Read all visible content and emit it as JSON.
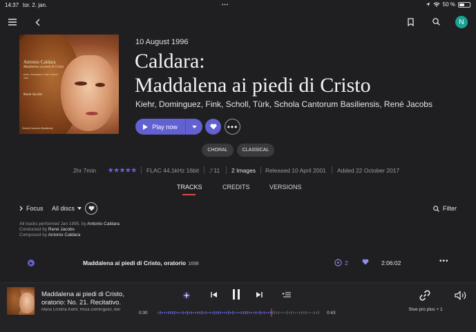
{
  "status_bar": {
    "time": "14:37",
    "date": "tor. 2. jan.",
    "battery": "50 %"
  },
  "album": {
    "release_date_top": "10 August 1996",
    "title_line1": "Caldara:",
    "title_line2": "Maddalena ai piedi di Cristo",
    "performers": "Kiehr, Dominguez, Fink, Scholl, Türk, Schola Cantorum Basiliensis, René Jacobs",
    "cover": {
      "composer": "Antonio Caldara",
      "work": "Maddalena ai piedi di Cristo",
      "singers": "Kiehr • Dominguez • Fink • Scholl • Türk",
      "ensemble": "Schola Cantorum Basiliensis",
      "conductor": "René Jacobs"
    }
  },
  "actions": {
    "play_label": "Play now"
  },
  "genres": [
    "CHORAL",
    "CLASSICAL"
  ],
  "meta": {
    "duration": "2hr 7min",
    "rating_stars": 5,
    "format": "FLAC 44.1kHz 16bit",
    "bitrate_count": "11",
    "images": "2 Images",
    "released": "Released 10 April 2001",
    "added": "Added 22 October 2017"
  },
  "tabs": {
    "tracks": "TRACKS",
    "credits": "CREDITS",
    "versions": "VERSIONS"
  },
  "toolbar": {
    "focus": "Focus",
    "discs": "All discs",
    "filter": "Filter"
  },
  "credits": {
    "performed_prefix": "All tracks performed Jan 1995, by ",
    "performed_name": "Antonio Caldara",
    "conducted_prefix": "Conducted by ",
    "conducted_name": "René Jacobs",
    "composed_prefix": "Composed by ",
    "composed_name": "Antonio Caldara"
  },
  "track": {
    "title": "Maddalena ai piedi di Cristo, oratorio",
    "year": "1698",
    "versions": "2",
    "duration": "2:06:02"
  },
  "now_playing": {
    "title_line1": "Maddalena ai piedi di Cristo,",
    "title_line2": "oratorio: No. 21. Recitativo.",
    "artists": "Maria Cristina Kiehr, Rosa Dominguez, Ber",
    "position": "0:30",
    "duration": "0:43",
    "progress": 0.7,
    "device": "Stue pro plus + 1"
  },
  "colors": {
    "accent": "#6261d2",
    "tab_underline": "#e0484a",
    "avatar": "#1aa295"
  }
}
